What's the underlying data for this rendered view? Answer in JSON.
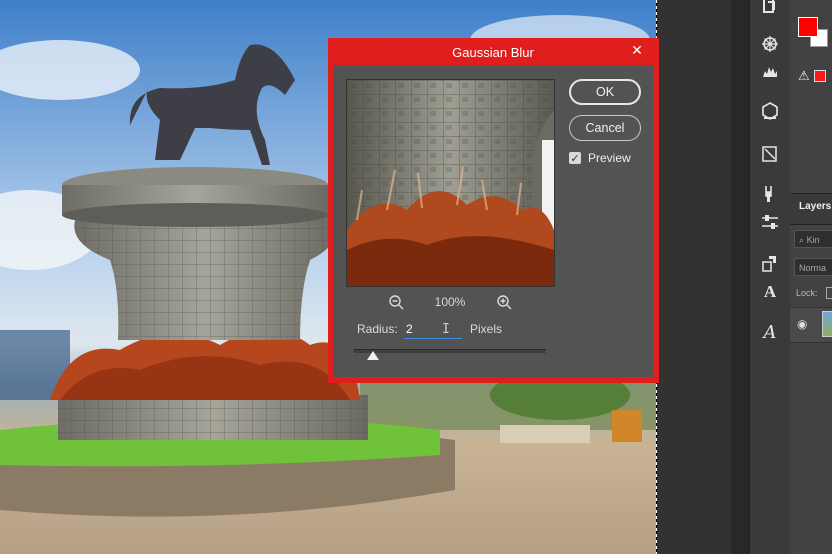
{
  "dialog": {
    "title": "Gaussian Blur",
    "close_glyph": "✕",
    "ok_label": "OK",
    "cancel_label": "Cancel",
    "preview_label": "Preview",
    "preview_checked": true,
    "zoom_level": "100%",
    "radius_label": "Radius:",
    "radius_value": "2",
    "radius_unit": "Pixels",
    "accent_color": "#e01e1e"
  },
  "layers_panel": {
    "title": "Layers",
    "search_placeholder": "Kin",
    "blend_mode": "Norma",
    "lock_label": "Lock:"
  },
  "colors": {
    "foreground": "#ff0000",
    "background": "#ffffff"
  },
  "icons": {
    "zoom_out": "zoom-out-icon",
    "zoom_in": "zoom-in-icon",
    "eye": "eye-icon",
    "warning": "warning-icon"
  }
}
